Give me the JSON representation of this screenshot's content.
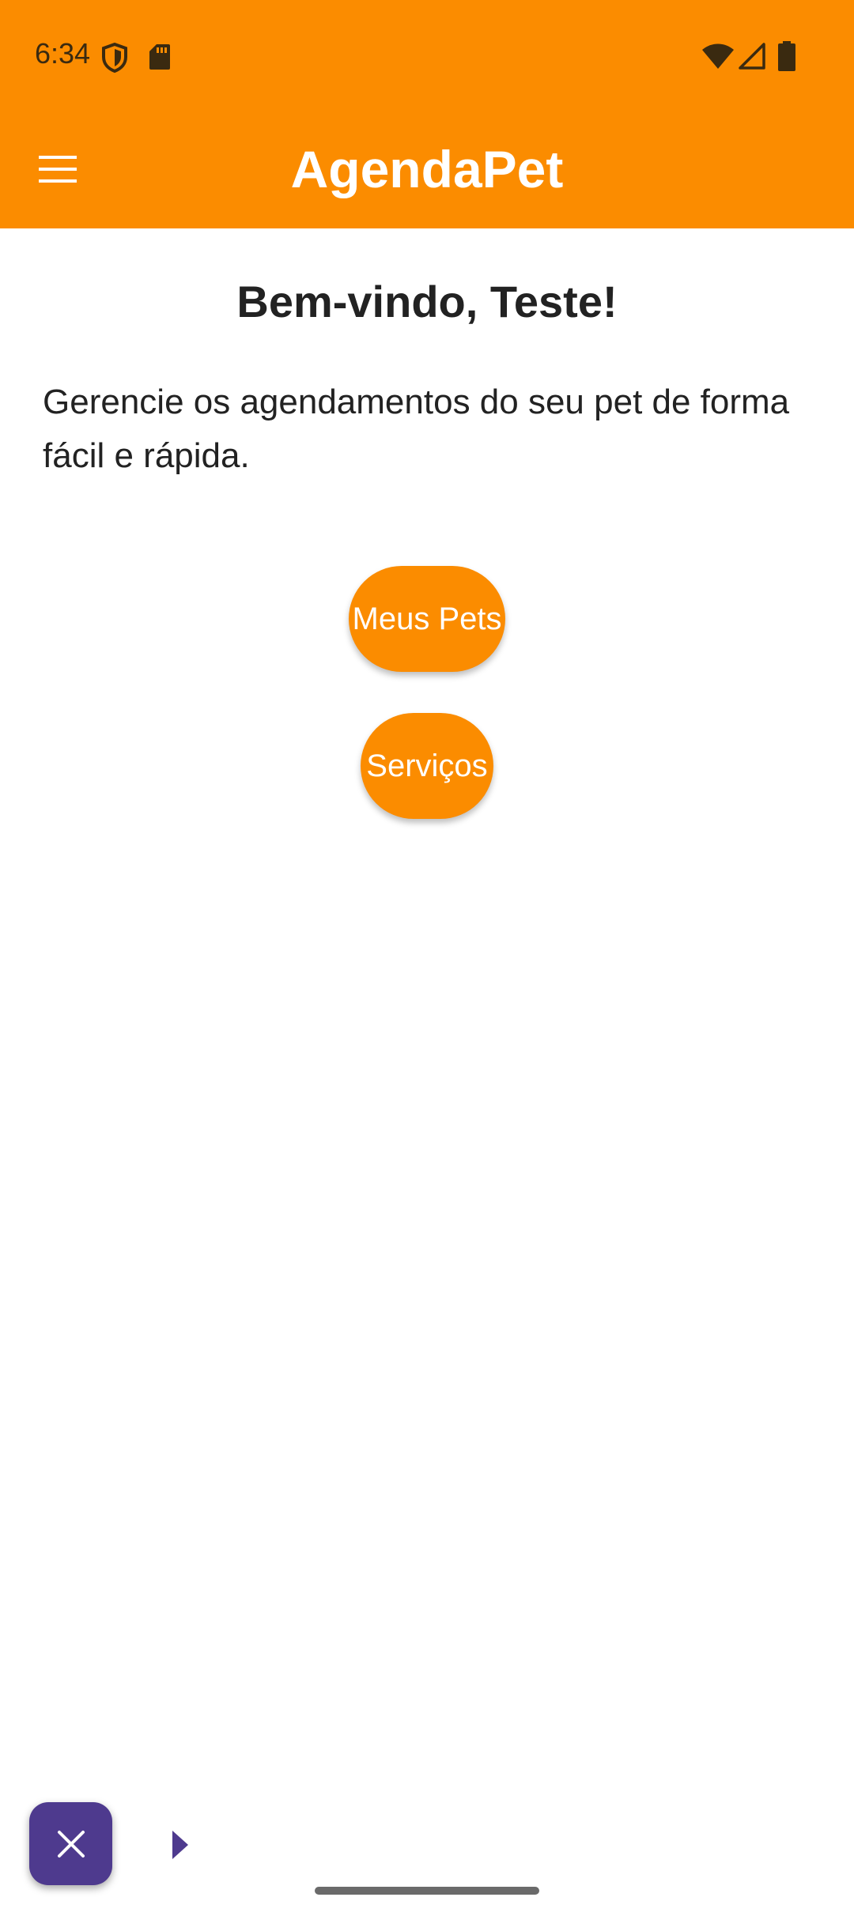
{
  "status_bar": {
    "time": "6:34",
    "icons": [
      "shield-icon",
      "sd-card-icon",
      "wifi-icon",
      "signal-icon",
      "battery-icon"
    ]
  },
  "app_bar": {
    "title": "AgendaPet",
    "menu_icon": "menu-icon"
  },
  "main": {
    "welcome_title": "Bem-vindo, Teste!",
    "description": "Gerencie os agendamentos do seu pet de forma fácil e rápida.",
    "buttons": [
      {
        "label": "Meus Pets"
      },
      {
        "label": "Serviços"
      }
    ]
  },
  "overlay": {
    "close_icon": "close-icon",
    "arrow_icon": "play-arrow-icon"
  },
  "colors": {
    "primary": "#FB8C00",
    "on_primary": "#FFFFFF",
    "fab": "#4E3A8E",
    "text": "#222222"
  }
}
